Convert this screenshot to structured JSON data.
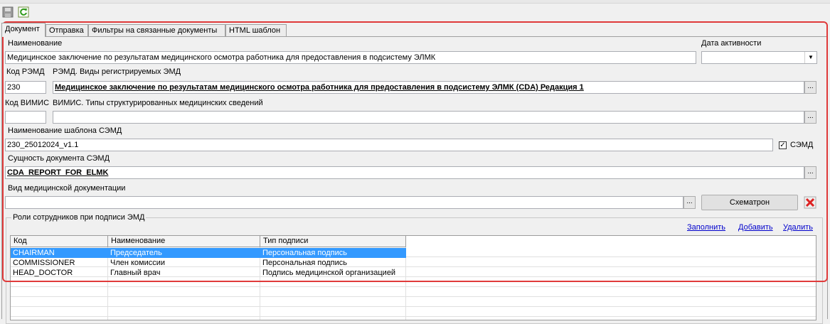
{
  "tabs": [
    "Документ",
    "Отправка",
    "Фильтры на связанные документы",
    "HTML шаблон"
  ],
  "labels": {
    "name": "Наименование",
    "activity_date": "Дата активности",
    "remd_code": "Код РЭМД",
    "remd_types": "РЭМД. Виды регистрируемых ЭМД",
    "vimis_code": "Код ВИМИС",
    "vimis_types": "ВИМИС. Типы структурированных медицинских сведений",
    "semd_template": "Наименование шаблона СЭМД",
    "semd_checkbox": "СЭМД",
    "semd_entity": "Сущность документа СЭМД",
    "med_doc_type": "Вид медицинской документации",
    "roles_group": "Роли сотрудников при подписи ЭМД"
  },
  "values": {
    "name": "Медицинское заключение по результатам медицинского осмотра работника для предоставления в подсистему ЭЛМК",
    "activity_date": "",
    "remd_code": "230",
    "remd_type": "Медицинское заключение по результатам медицинского осмотра работника для предоставления в подсистему ЭЛМК (CDA) Редакция 1",
    "vimis_code": "",
    "vimis_type": "",
    "semd_template": "230_25012024_v1.1",
    "semd_checked": true,
    "semd_entity": "CDA_REPORT_FOR_ELMK",
    "med_doc_type": ""
  },
  "buttons": {
    "ellipsis": "...",
    "schematron": "Схематрон"
  },
  "links": {
    "fill": "Заполнить",
    "add": "Добавить",
    "delete": "Удалить"
  },
  "grid": {
    "columns": [
      "Код",
      "Наименование",
      "Тип подписи"
    ],
    "rows": [
      {
        "code": "CHAIRMAN",
        "name": "Председатель",
        "sign_type": "Персональная подпись",
        "selected": true
      },
      {
        "code": "COMMISSIONER",
        "name": "Член комиссии",
        "sign_type": "Персональная подпись",
        "selected": false
      },
      {
        "code": "HEAD_DOCTOR",
        "name": "Главный врач",
        "sign_type": "Подпись медицинской организацией",
        "selected": false
      }
    ]
  },
  "colors": {
    "highlight": "#e03a3a",
    "selection": "#3399ff",
    "link": "#0000cc"
  }
}
